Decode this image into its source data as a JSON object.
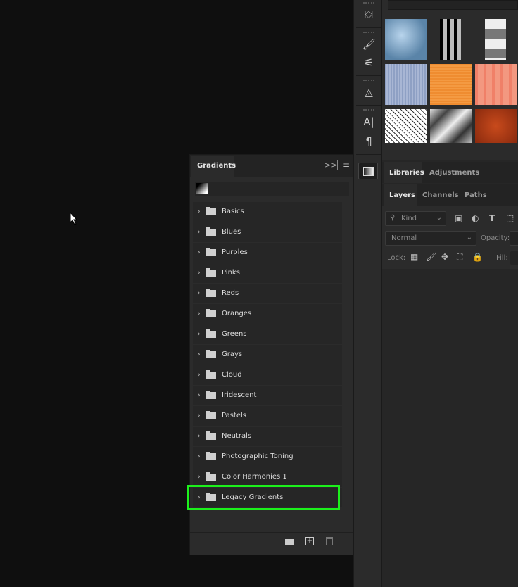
{
  "gradients_panel": {
    "tab": "Gradients",
    "collapse_icon": "double-chevron-right-icon",
    "menu_icon": "hamburger-menu-icon",
    "folders": [
      "Basics",
      "Blues",
      "Purples",
      "Pinks",
      "Reds",
      "Oranges",
      "Greens",
      "Grays",
      "Cloud",
      "Iridescent",
      "Pastels",
      "Neutrals",
      "Photographic Toning",
      "Color Harmonies 1",
      "Legacy Gradients"
    ],
    "highlighted_folder": "Legacy Gradients",
    "highlight_color": "#1cf01c"
  },
  "right_panels": {
    "libraries_tabs": [
      "Libraries",
      "Adjustments"
    ],
    "layers_tabs": [
      "Layers",
      "Channels",
      "Paths"
    ],
    "kind_filter": "Kind",
    "blend_mode": "Normal",
    "opacity_label": "Opacity:",
    "lock_label": "Lock:",
    "fill_label": "Fill:"
  }
}
